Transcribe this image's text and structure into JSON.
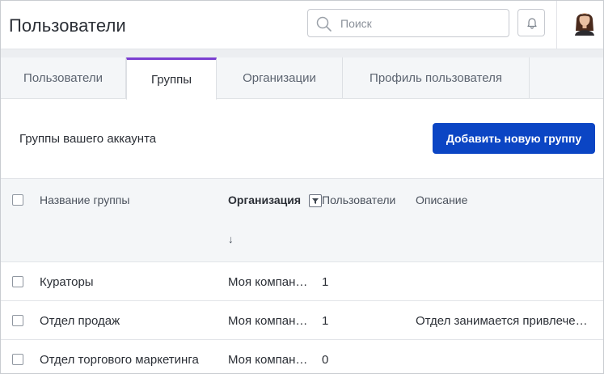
{
  "header": {
    "title": "Пользователи",
    "search_placeholder": "Поиск",
    "search_icon": "search-icon",
    "bell_icon": "bell-icon"
  },
  "tabs": [
    {
      "label": "Пользователи",
      "active": false
    },
    {
      "label": "Группы",
      "active": true
    },
    {
      "label": "Организации",
      "active": false
    },
    {
      "label": "Профиль пользователя",
      "active": false
    }
  ],
  "section": {
    "title": "Группы вашего аккаунта",
    "add_button": "Добавить новую группу"
  },
  "table": {
    "columns": {
      "name": "Название группы",
      "organization": "Организация",
      "users": "Пользователи",
      "description": "Описание"
    },
    "sort_indicator": "↓",
    "rows": [
      {
        "name": "Кураторы",
        "organization": "Моя компан…",
        "users": "1",
        "description": ""
      },
      {
        "name": "Отдел продаж",
        "organization": "Моя компан…",
        "users": "1",
        "description": "Отдел занимается привлече…"
      },
      {
        "name": "Отдел торгового маркетинга",
        "organization": "Моя компан…",
        "users": "0",
        "description": ""
      }
    ]
  },
  "colors": {
    "accent_tab": "#7b3fd1",
    "primary_button": "#0b45c4"
  }
}
